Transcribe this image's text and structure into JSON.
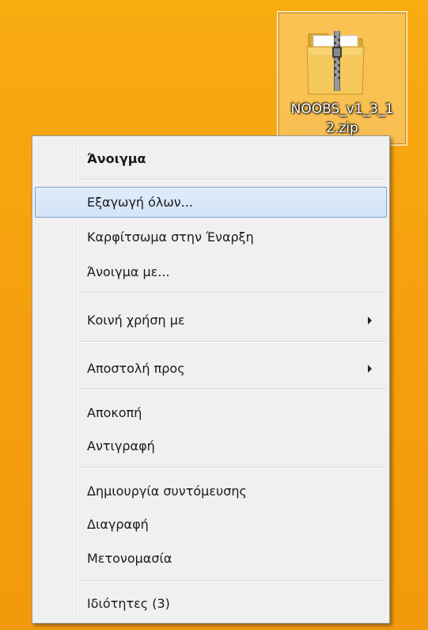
{
  "desktop": {
    "background_color": "#f5a20f",
    "icon": {
      "name_line1": "NOOBS_v1_3_1",
      "name_line2": "2.zip",
      "icon_name": "zip-folder-icon"
    }
  },
  "context_menu": {
    "highlight_color": "#d3e4f8",
    "items": {
      "open": {
        "label": "Άνοιγμα"
      },
      "extract_all": {
        "label": "Εξαγωγή όλων..."
      },
      "pin_start": {
        "label": "Καρφίτσωμα στην Έναρξη"
      },
      "open_with": {
        "label": "Άνοιγμα με..."
      },
      "share_with": {
        "label": "Κοινή χρήση με"
      },
      "send_to": {
        "label": "Αποστολή προς"
      },
      "cut": {
        "label": "Αποκοπή"
      },
      "copy": {
        "label": "Αντιγραφή"
      },
      "create_shortcut": {
        "label": "Δημιουργία συντόμευσης"
      },
      "delete": {
        "label": "Διαγραφή"
      },
      "rename": {
        "label": "Μετονομασία"
      },
      "properties": {
        "label": "Ιδιότητες (3)"
      }
    }
  }
}
